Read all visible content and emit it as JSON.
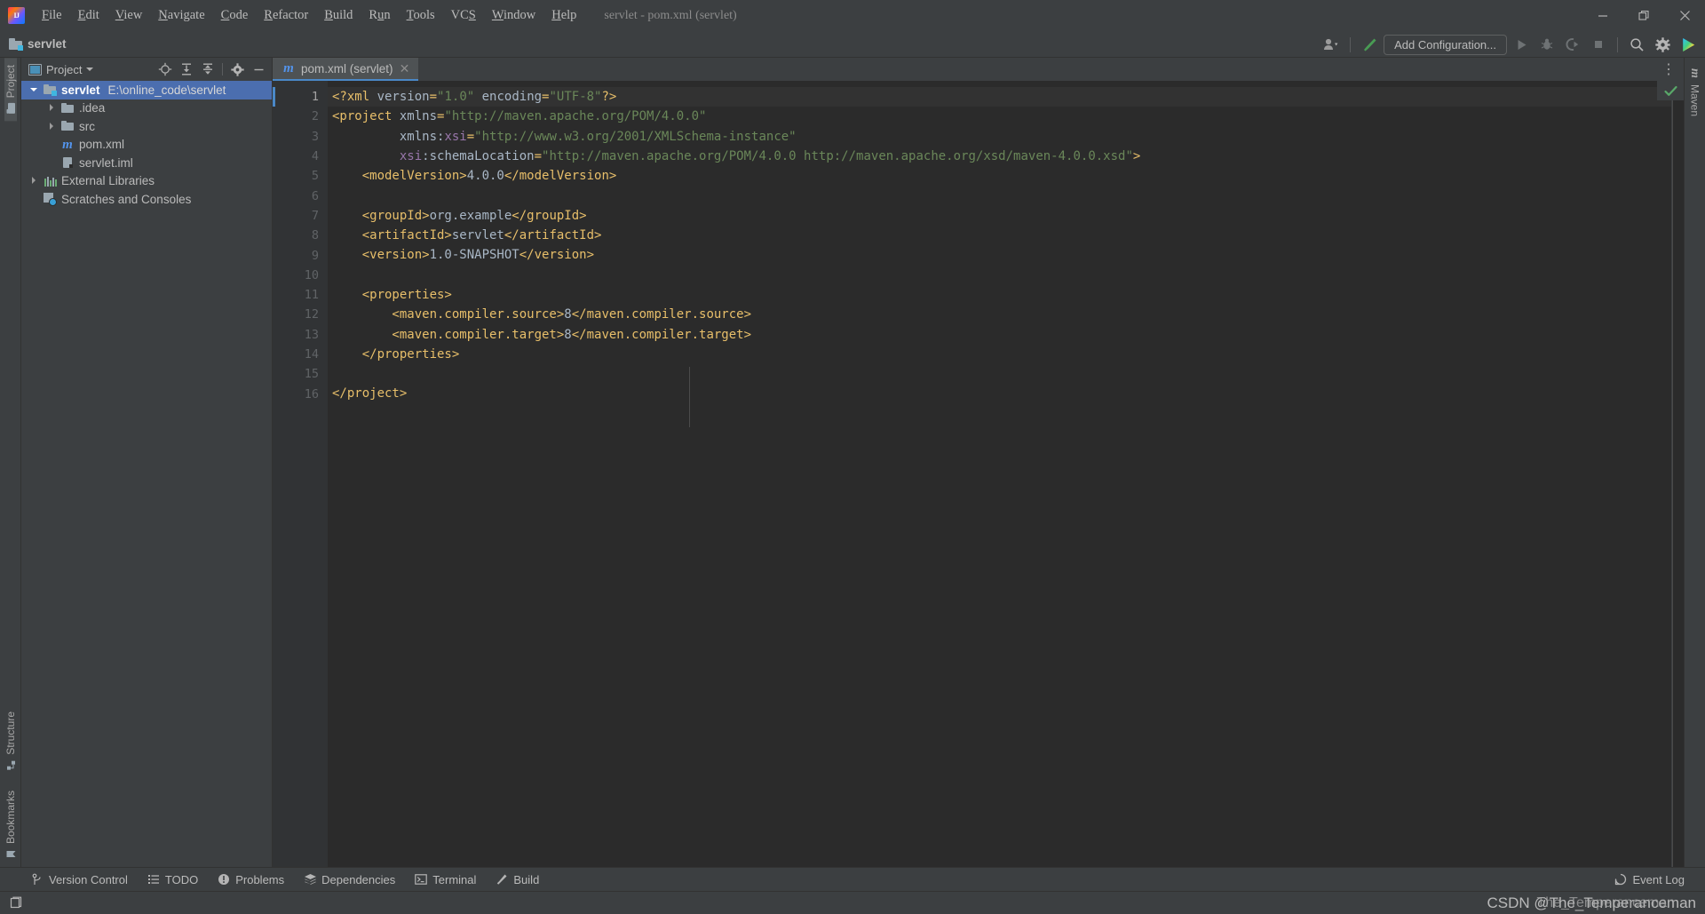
{
  "window": {
    "title": "servlet - pom.xml (servlet)",
    "controls": {
      "minimize": "minimize-icon",
      "maximize": "maximize-icon",
      "close": "close-icon"
    }
  },
  "menubar": {
    "logo": "intellij-idea-logo",
    "items": [
      {
        "label": "File",
        "mnemonic": "F"
      },
      {
        "label": "Edit",
        "mnemonic": "E"
      },
      {
        "label": "View",
        "mnemonic": "V"
      },
      {
        "label": "Navigate",
        "mnemonic": "N"
      },
      {
        "label": "Code",
        "mnemonic": "C"
      },
      {
        "label": "Refactor",
        "mnemonic": "R"
      },
      {
        "label": "Build",
        "mnemonic": "B"
      },
      {
        "label": "Run",
        "mnemonic": "u"
      },
      {
        "label": "Tools",
        "mnemonic": "T"
      },
      {
        "label": "VCS",
        "mnemonic": "S"
      },
      {
        "label": "Window",
        "mnemonic": "W"
      },
      {
        "label": "Help",
        "mnemonic": "H"
      }
    ]
  },
  "navbar": {
    "breadcrumb": "servlet",
    "run_configuration_label": "Add Configuration...",
    "icons": {
      "user": "user-account-icon",
      "build": "build-hammer-icon",
      "run": "run-icon",
      "debug": "debug-icon",
      "run_coverage": "run-with-coverage-icon",
      "stop": "stop-icon",
      "search": "search-everywhere-icon",
      "settings": "settings-gear-icon",
      "updates": "idea-updates-icon"
    }
  },
  "left_stripe": {
    "top": [
      {
        "label": "Project",
        "icon": "project-folder-icon",
        "active": true
      }
    ],
    "bottom": [
      {
        "label": "Structure",
        "icon": "structure-icon"
      },
      {
        "label": "Bookmarks",
        "icon": "bookmark-icon"
      }
    ]
  },
  "right_stripe": {
    "items": [
      {
        "label": "Maven",
        "icon": "maven-m-icon"
      }
    ]
  },
  "project_panel": {
    "title": "Project",
    "view_icon": "project-view-icon",
    "dropdown_icon": "chevron-down-icon",
    "actions": [
      {
        "name": "select-opened-file",
        "icon": "crosshair-target-icon"
      },
      {
        "name": "expand-all",
        "icon": "expand-all-icon"
      },
      {
        "name": "collapse-all",
        "icon": "collapse-all-icon"
      },
      {
        "name": "project-settings",
        "icon": "gear-icon"
      },
      {
        "name": "hide-tool-window",
        "icon": "minimize-icon"
      }
    ],
    "tree": [
      {
        "label": "servlet",
        "path": "E:\\online_code\\servlet",
        "icon": "module-folder-icon",
        "indent": 0,
        "arrow": "down",
        "selected": true,
        "bold": true
      },
      {
        "label": ".idea",
        "path": "",
        "icon": "folder-icon",
        "indent": 1,
        "arrow": "right",
        "selected": false,
        "bold": false
      },
      {
        "label": "src",
        "path": "",
        "icon": "folder-icon",
        "indent": 1,
        "arrow": "right",
        "selected": false,
        "bold": false
      },
      {
        "label": "pom.xml",
        "path": "",
        "icon": "maven-pom-icon",
        "indent": 1,
        "arrow": "none",
        "selected": false,
        "bold": false
      },
      {
        "label": "servlet.iml",
        "path": "",
        "icon": "iml-file-icon",
        "indent": 1,
        "arrow": "none",
        "selected": false,
        "bold": false
      },
      {
        "label": "External Libraries",
        "path": "",
        "icon": "libraries-icon",
        "indent": 0,
        "arrow": "right",
        "selected": false,
        "bold": false
      },
      {
        "label": "Scratches and Consoles",
        "path": "",
        "icon": "scratches-icon",
        "indent": 0,
        "arrow": "none",
        "selected": false,
        "bold": false
      }
    ]
  },
  "editor": {
    "tabs": [
      {
        "label": "pom.xml (servlet)",
        "icon": "maven-pom-icon",
        "active": true,
        "close_icon": "close-icon"
      }
    ],
    "tab_options_icon": "more-options-icon",
    "inspection_status_icon": "inspections-ok-checkmark",
    "inspection_status_color": "#59a869",
    "caret_line": 1,
    "lines": [
      {
        "n": 1,
        "fold": "none",
        "tokens": [
          {
            "t": "punct",
            "v": "<?xml "
          },
          {
            "t": "plain",
            "v": "version"
          },
          {
            "t": "punct",
            "v": "="
          },
          {
            "t": "strv",
            "v": "\"1.0\""
          },
          {
            "t": "plain",
            "v": " encoding"
          },
          {
            "t": "punct",
            "v": "="
          },
          {
            "t": "strv",
            "v": "\"UTF-8\""
          },
          {
            "t": "punct",
            "v": "?>"
          }
        ]
      },
      {
        "n": 2,
        "fold": "open",
        "tokens": [
          {
            "t": "tagname",
            "v": "<project "
          },
          {
            "t": "plain",
            "v": "xmlns"
          },
          {
            "t": "punct",
            "v": "="
          },
          {
            "t": "strv",
            "v": "\"http://maven.apache.org/POM/4.0.0\""
          }
        ]
      },
      {
        "n": 3,
        "fold": "none",
        "tokens": [
          {
            "t": "plain",
            "v": "         xmlns:"
          },
          {
            "t": "attrname",
            "v": "xsi"
          },
          {
            "t": "punct",
            "v": "="
          },
          {
            "t": "strv",
            "v": "\"http://www.w3.org/2001/XMLSchema-instance\""
          }
        ]
      },
      {
        "n": 4,
        "fold": "none",
        "tokens": [
          {
            "t": "plain",
            "v": "         "
          },
          {
            "t": "attrname",
            "v": "xsi"
          },
          {
            "t": "plain",
            "v": ":schemaLocation"
          },
          {
            "t": "punct",
            "v": "="
          },
          {
            "t": "strv",
            "v": "\"http://maven.apache.org/POM/4.0.0 http://maven.apache.org/xsd/maven-4.0.0.xsd\""
          },
          {
            "t": "tagname",
            "v": ">"
          }
        ]
      },
      {
        "n": 5,
        "fold": "none",
        "tokens": [
          {
            "t": "tagname",
            "v": "    <modelVersion>"
          },
          {
            "t": "txtv",
            "v": "4.0.0"
          },
          {
            "t": "tagname",
            "v": "</modelVersion>"
          }
        ]
      },
      {
        "n": 6,
        "fold": "none",
        "tokens": []
      },
      {
        "n": 7,
        "fold": "none",
        "tokens": [
          {
            "t": "tagname",
            "v": "    <groupId>"
          },
          {
            "t": "txtv",
            "v": "org.example"
          },
          {
            "t": "tagname",
            "v": "</groupId>"
          }
        ]
      },
      {
        "n": 8,
        "fold": "none",
        "tokens": [
          {
            "t": "tagname",
            "v": "    <artifactId>"
          },
          {
            "t": "txtv",
            "v": "servlet"
          },
          {
            "t": "tagname",
            "v": "</artifactId>"
          }
        ]
      },
      {
        "n": 9,
        "fold": "none",
        "tokens": [
          {
            "t": "tagname",
            "v": "    <version>"
          },
          {
            "t": "txtv",
            "v": "1.0-SNAPSHOT"
          },
          {
            "t": "tagname",
            "v": "</version>"
          }
        ]
      },
      {
        "n": 10,
        "fold": "none",
        "tokens": []
      },
      {
        "n": 11,
        "fold": "open",
        "tokens": [
          {
            "t": "tagname",
            "v": "    <properties>"
          }
        ]
      },
      {
        "n": 12,
        "fold": "none",
        "tokens": [
          {
            "t": "tagname",
            "v": "        <maven.compiler.source>"
          },
          {
            "t": "txtv",
            "v": "8"
          },
          {
            "t": "tagname",
            "v": "</maven.compiler.source>"
          }
        ]
      },
      {
        "n": 13,
        "fold": "none",
        "tokens": [
          {
            "t": "tagname",
            "v": "        <maven.compiler.target>"
          },
          {
            "t": "txtv",
            "v": "8"
          },
          {
            "t": "tagname",
            "v": "</maven.compiler.target>"
          }
        ]
      },
      {
        "n": 14,
        "fold": "end",
        "tokens": [
          {
            "t": "tagname",
            "v": "    </properties>"
          }
        ]
      },
      {
        "n": 15,
        "fold": "none",
        "tokens": []
      },
      {
        "n": 16,
        "fold": "end",
        "tokens": [
          {
            "t": "tagname",
            "v": "</project>"
          }
        ]
      }
    ]
  },
  "bottom_bar": {
    "items": [
      {
        "label": "Version Control",
        "icon": "version-control-branch-icon"
      },
      {
        "label": "TODO",
        "icon": "todo-list-icon"
      },
      {
        "label": "Problems",
        "icon": "problems-warning-icon"
      },
      {
        "label": "Dependencies",
        "icon": "dependencies-layers-icon"
      },
      {
        "label": "Terminal",
        "icon": "terminal-icon"
      },
      {
        "label": "Build",
        "icon": "build-hammer-icon"
      }
    ],
    "right": [
      {
        "label": "Event Log",
        "icon": "event-log-icon"
      }
    ]
  },
  "status_bar": {
    "layout_icon": "layout-toggle-icon",
    "watermark": "CSDN @The_Temperanceman",
    "watermark_ghost": "The_Temperanceman"
  },
  "colors": {
    "chrome_bg": "#3c3f41",
    "editor_bg": "#2b2b2b",
    "gutter_bg": "#313335",
    "selection_blue": "#4b6eaf",
    "tab_active": "#4e5254",
    "accent_blue": "#4a88c7",
    "tag_orange": "#e8bf6a",
    "string_green": "#6a8759",
    "attr_purple": "#9876aa",
    "text_gray": "#a9b7c6",
    "ok_green": "#59a869"
  }
}
